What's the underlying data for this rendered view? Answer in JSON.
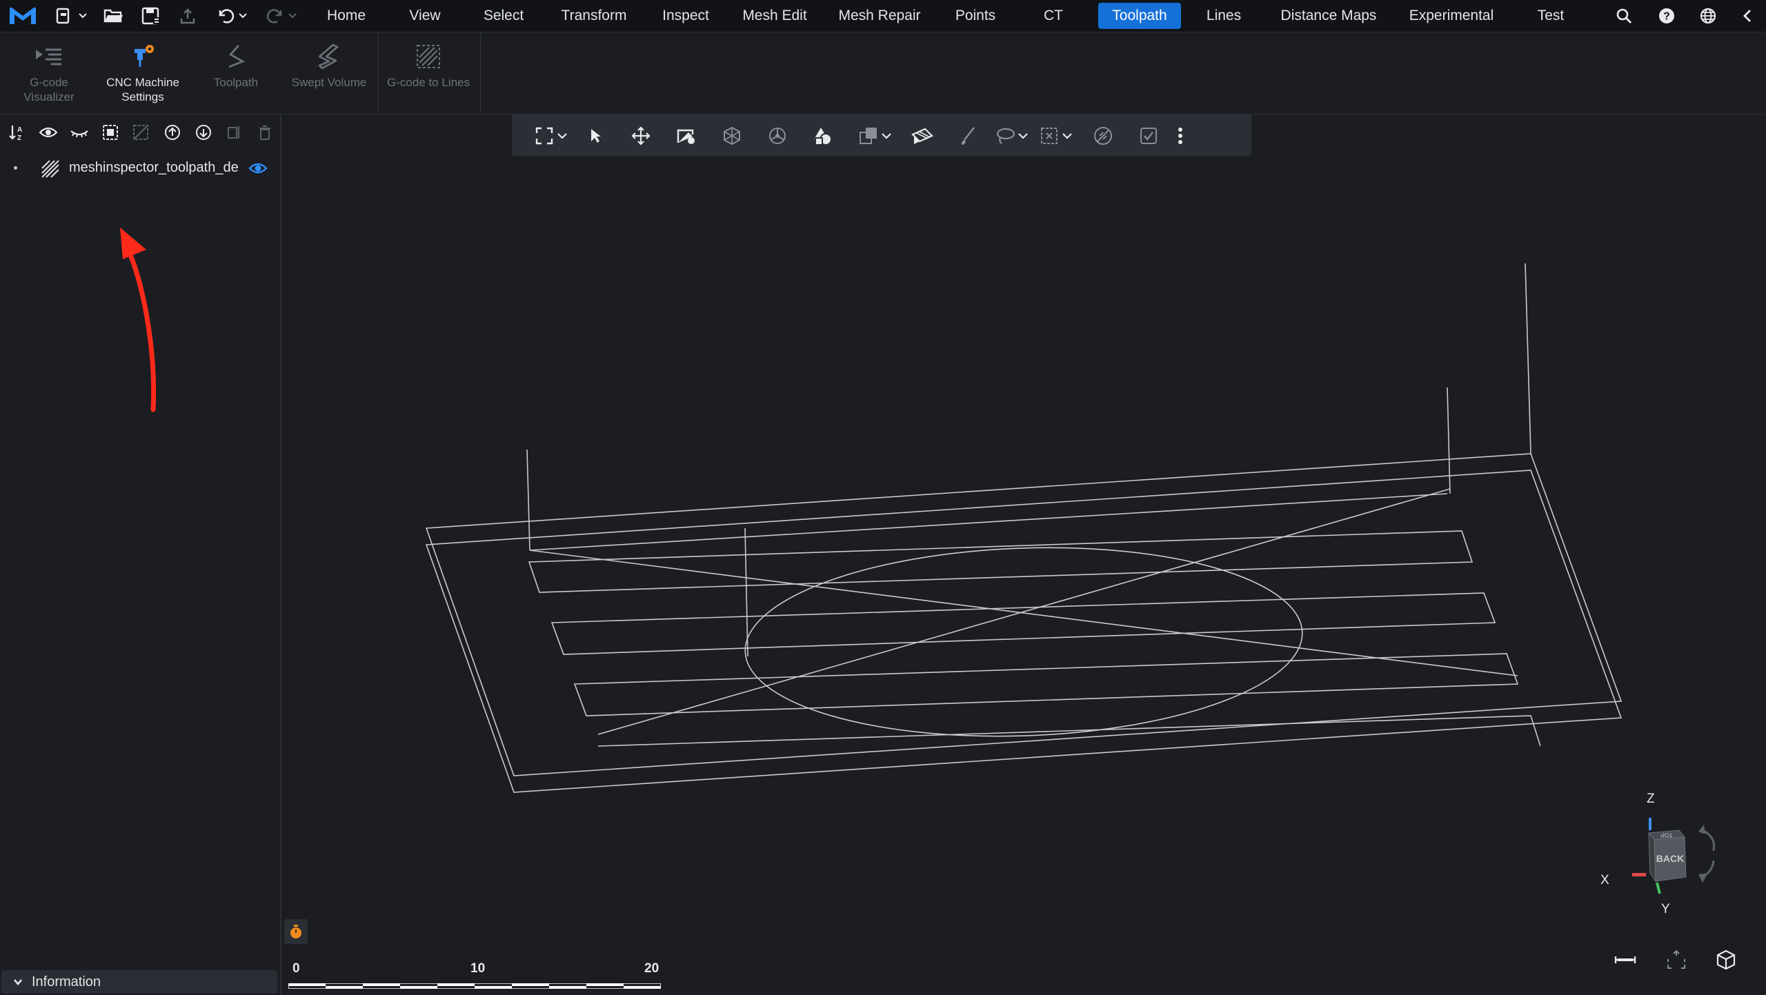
{
  "menu": {
    "tabs": [
      {
        "label": "Home"
      },
      {
        "label": "View"
      },
      {
        "label": "Select"
      },
      {
        "label": "Transform"
      },
      {
        "label": "Inspect"
      },
      {
        "label": "Mesh Edit"
      },
      {
        "label": "Mesh Repair"
      },
      {
        "label": "Points"
      },
      {
        "label": "CT"
      },
      {
        "label": "Toolpath"
      },
      {
        "label": "Lines"
      },
      {
        "label": "Distance Maps"
      },
      {
        "label": "Experimental"
      },
      {
        "label": "Test"
      }
    ],
    "active_tab": "Toolpath",
    "accent_color": "#1571d8",
    "left_icons": [
      "app-logo-icon",
      "new-file-icon",
      "open-folder-icon",
      "save-icon",
      "export-icon",
      "undo-icon",
      "redo-icon"
    ],
    "right_icons": [
      "search-icon",
      "help-icon",
      "language-globe-icon",
      "collapse-chevron-icon"
    ]
  },
  "ribbon": {
    "buttons": [
      {
        "label": "G-code\nVisualizer",
        "icon": "gcode-visualizer-icon",
        "enabled": false
      },
      {
        "label": "CNC Machine\nSettings",
        "icon": "cnc-settings-icon",
        "enabled": true
      },
      {
        "label": "Toolpath",
        "icon": "toolpath-icon",
        "enabled": false
      },
      {
        "label": "Swept Volume",
        "icon": "swept-volume-icon",
        "enabled": false
      },
      {
        "label": "G-code to Lines",
        "icon": "gcode-to-lines-icon",
        "enabled": false
      }
    ]
  },
  "scene_tree": {
    "toolbar_icons": [
      "sort-az-icon",
      "show-all-icon",
      "hide-all-icon",
      "select-all-icon",
      "deselect-icon",
      "move-up-icon",
      "move-down-icon",
      "duplicate-icon",
      "delete-icon"
    ],
    "objects": [
      {
        "name": "meshinspector_toolpath_de",
        "type_icon": "lines-object-icon",
        "visible": true
      }
    ],
    "annotation_arrow_color": "#ff2a1a"
  },
  "info_panel": {
    "label": "Information",
    "collapsed": false
  },
  "viewport_toolbar": {
    "icons": [
      "fit-view-icon",
      "dropdown-chevron-icon",
      "select-pointer-icon",
      "move-icon",
      "edit-object-icon",
      "transform-icon",
      "wheel-icon",
      "shapes-icon",
      "clone-icon",
      "dropdown-chevron-icon",
      "surface-paint-icon",
      "brush-icon",
      "lasso-icon",
      "dropdown-chevron-icon",
      "box-select-icon",
      "dropdown-chevron-icon",
      "no-select-icon",
      "checkbox-icon",
      "more-menu-icon"
    ]
  },
  "scale_bar": {
    "labels": [
      "0",
      "10",
      "20"
    ]
  },
  "view_cube": {
    "face_label": "BACK",
    "top_label": "TOP",
    "axes": [
      "X",
      "Y",
      "Z"
    ],
    "axis_colors": {
      "x": "#e04848",
      "y": "#43c160",
      "z": "#3f8ff0"
    }
  },
  "bottom_right_icons": [
    "measure-icon",
    "fit-screen-icon",
    "view-cube-icon"
  ]
}
